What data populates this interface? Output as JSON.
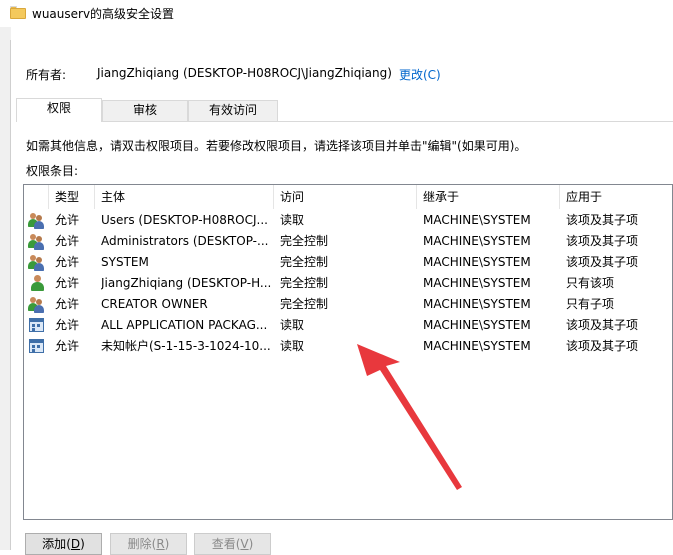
{
  "window": {
    "title": "wuauserv的高级安全设置"
  },
  "owner": {
    "label": "所有者:",
    "value": "JiangZhiqiang (DESKTOP-H08ROCJ\\JiangZhiqiang)",
    "change_link": "更改(C)"
  },
  "tabs": [
    {
      "label": "权限",
      "active": true
    },
    {
      "label": "审核",
      "active": false
    },
    {
      "label": "有效访问",
      "active": false
    }
  ],
  "info_text": "如需其他信息，请双击权限项目。若要修改权限项目，请选择该项目并单击\"编辑\"(如果可用)。",
  "entries_label": "权限条目:",
  "columns": [
    "类型",
    "主体",
    "访问",
    "继承于",
    "应用于"
  ],
  "rows": [
    {
      "icon": "users-group-icon",
      "type": "允许",
      "principal": "Users (DESKTOP-H08ROCJ...",
      "access": "读取",
      "inherited": "MACHINE\\SYSTEM",
      "applies": "该项及其子项"
    },
    {
      "icon": "users-group-icon",
      "type": "允许",
      "principal": "Administrators (DESKTOP-...",
      "access": "完全控制",
      "inherited": "MACHINE\\SYSTEM",
      "applies": "该项及其子项"
    },
    {
      "icon": "users-group-icon",
      "type": "允许",
      "principal": "SYSTEM",
      "access": "完全控制",
      "inherited": "MACHINE\\SYSTEM",
      "applies": "该项及其子项"
    },
    {
      "icon": "user-icon",
      "type": "允许",
      "principal": "JiangZhiqiang (DESKTOP-H...",
      "access": "完全控制",
      "inherited": "MACHINE\\SYSTEM",
      "applies": "只有该项"
    },
    {
      "icon": "users-group-icon",
      "type": "允许",
      "principal": "CREATOR OWNER",
      "access": "完全控制",
      "inherited": "MACHINE\\SYSTEM",
      "applies": "只有子项"
    },
    {
      "icon": "app-package-icon",
      "type": "允许",
      "principal": "ALL APPLICATION PACKAG...",
      "access": "读取",
      "inherited": "MACHINE\\SYSTEM",
      "applies": "该项及其子项"
    },
    {
      "icon": "app-package-icon",
      "type": "允许",
      "principal": "未知帐户(S-1-15-3-1024-10...",
      "access": "读取",
      "inherited": "MACHINE\\SYSTEM",
      "applies": "该项及其子项"
    }
  ],
  "buttons": {
    "add": {
      "label": "添加",
      "key": "D"
    },
    "remove": {
      "label": "删除",
      "key": "R"
    },
    "view": {
      "label": "查看",
      "key": "V"
    }
  },
  "colors": {
    "link": "#0066cc",
    "arrow": "#e8383d",
    "list_border": "#828790"
  }
}
